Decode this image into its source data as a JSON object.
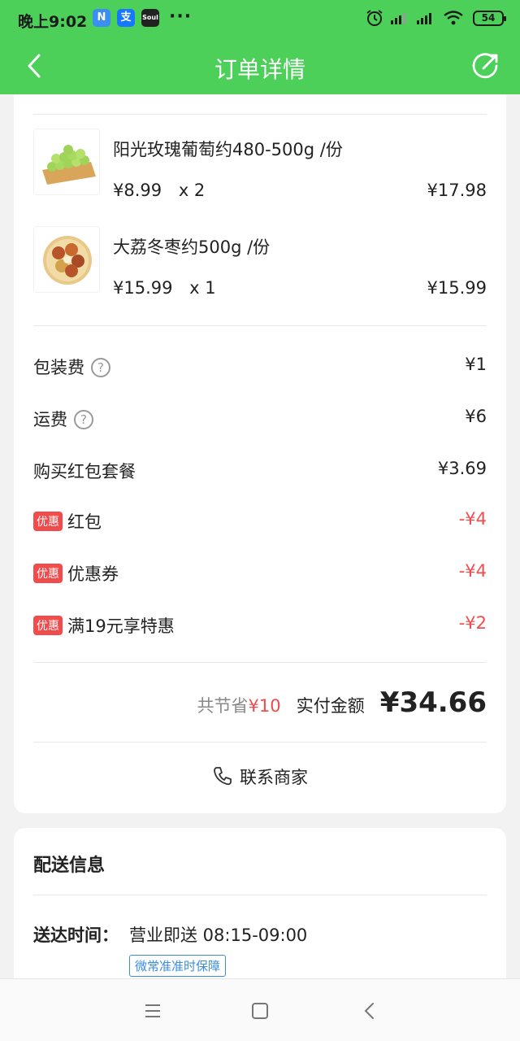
{
  "status_bar": {
    "time": "晚上9:02",
    "apps": [
      {
        "name": "N",
        "color": "#3b8ef3"
      },
      {
        "name": "支",
        "color": "#1677ff"
      },
      {
        "name": "Soul",
        "color": "#222222"
      }
    ],
    "more": "···",
    "battery": "54"
  },
  "header": {
    "title": "订单详情",
    "background": "#4cd05a"
  },
  "products": [
    {
      "name": "阳光玫瑰葡萄约480-500g /份",
      "price": "¥8.99",
      "qty": "x 2",
      "total": "¥17.98",
      "image": "grape-image"
    },
    {
      "name": "大荔冬枣约500g /份",
      "price": "¥15.99",
      "qty": "x 1",
      "total": "¥15.99",
      "image": "jujube-image"
    }
  ],
  "fees": {
    "packaging": {
      "label": "包装费",
      "value": "¥1",
      "help": "?"
    },
    "delivery": {
      "label": "运费",
      "value": "¥6",
      "help": "?"
    },
    "red_packet_bundle": {
      "label": "购买红包套餐",
      "value": "¥3.69"
    }
  },
  "discounts": [
    {
      "badge": "优惠",
      "label": "红包",
      "value": "-¥4"
    },
    {
      "badge": "优惠",
      "label": "优惠券",
      "value": "-¥4"
    },
    {
      "badge": "优惠",
      "label": "满19元享特惠",
      "value": "-¥2"
    }
  ],
  "summary": {
    "saved_label": "共节省",
    "saved_amount": "¥10",
    "paid_label": "实付金额",
    "paid_amount": "¥34.66"
  },
  "contact": {
    "label": "联系商家"
  },
  "delivery_info": {
    "title": "配送信息",
    "time_label": "送达时间：",
    "time_value": "营业即送 08:15-09:00",
    "tag": "微常准准时保障"
  },
  "colors": {
    "accent": "#4cd05a",
    "discount": "#f24b4b",
    "tag": "#3a8dde"
  }
}
